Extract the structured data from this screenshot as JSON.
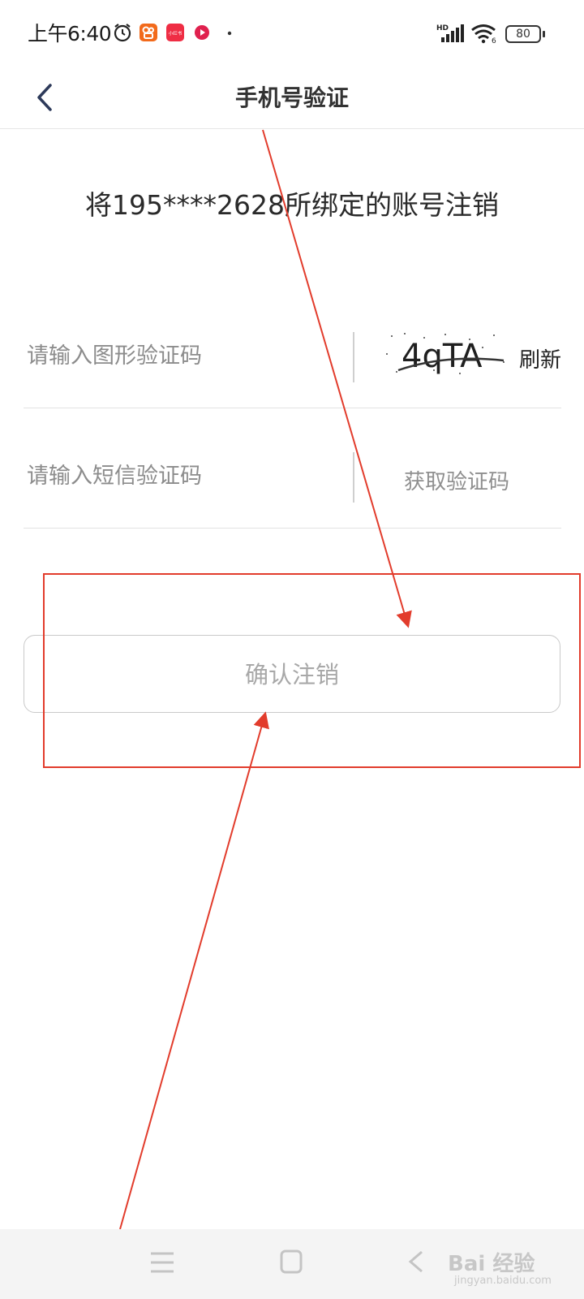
{
  "status_bar": {
    "time": "上午6:40",
    "app_badge_label": "小红书",
    "battery": "80",
    "network": "HD",
    "wifi_badge": "6"
  },
  "header": {
    "title": "手机号验证"
  },
  "account_notice": "将195****2628所绑定的账号注销",
  "form": {
    "captcha_placeholder": "请输入图形验证码",
    "captcha_text": "4qTA",
    "refresh_label": "刷新",
    "sms_placeholder": "请输入短信验证码",
    "get_code_label": "获取验证码"
  },
  "confirm_label": "确认注销",
  "watermark": {
    "brand": "Bai 经验",
    "url": "jingyan.baidu.com"
  },
  "colors": {
    "annotation": "#e23c2c",
    "text": "#333333",
    "placeholder": "#8c8c8c"
  }
}
